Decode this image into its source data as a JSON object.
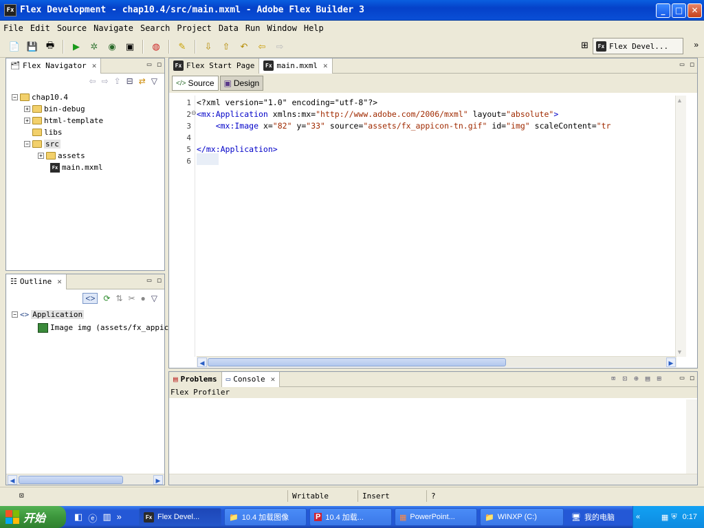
{
  "window": {
    "title": "Flex Development - chap10.4/src/main.mxml - Adobe Flex Builder 3",
    "app_badge": "Fx",
    "minimize": "_",
    "maximize": "□",
    "close": "✕"
  },
  "menu": [
    "File",
    "Edit",
    "Source",
    "Navigate",
    "Search",
    "Project",
    "Data",
    "Run",
    "Window",
    "Help"
  ],
  "perspective": {
    "label": "Flex Devel...",
    "more": "»"
  },
  "navigator": {
    "tab": "Flex Navigator",
    "items": [
      {
        "label": "chap10.4",
        "level": 0,
        "exp": "−",
        "icon": "project"
      },
      {
        "label": "bin-debug",
        "level": 1,
        "exp": "+",
        "icon": "folder"
      },
      {
        "label": "html-template",
        "level": 1,
        "exp": "+",
        "icon": "folder"
      },
      {
        "label": "libs",
        "level": 1,
        "exp": "",
        "icon": "folder"
      },
      {
        "label": "src",
        "level": 1,
        "exp": "−",
        "icon": "folder"
      },
      {
        "label": "assets",
        "level": 2,
        "exp": "+",
        "icon": "folder"
      },
      {
        "label": "main.mxml",
        "level": 2,
        "exp": "",
        "icon": "mxml"
      }
    ]
  },
  "outline": {
    "tab": "Outline",
    "items": [
      {
        "label": "Application",
        "level": 0
      },
      {
        "label": "Image img (assets/fx_appicon",
        "level": 1
      }
    ]
  },
  "editor": {
    "tabs": [
      "Flex Start Page",
      "main.mxml"
    ],
    "modes": {
      "source": "Source",
      "design": "Design"
    },
    "lines": [
      [
        {
          "t": "<?xml version=\"1.0\" encoding=\"utf-8\"?>",
          "c": "att"
        }
      ],
      [
        {
          "t": "<mx:Application",
          "c": "tag"
        },
        {
          "t": " xmlns:mx=",
          "c": "att"
        },
        {
          "t": "\"http://www.adobe.com/2006/mxml\"",
          "c": "str"
        },
        {
          "t": " layout=",
          "c": "att"
        },
        {
          "t": "\"absolute\"",
          "c": "str"
        },
        {
          "t": ">",
          "c": "tag"
        }
      ],
      [
        {
          "t": "    <mx:Image",
          "c": "tag"
        },
        {
          "t": " x=",
          "c": "att"
        },
        {
          "t": "\"82\"",
          "c": "str"
        },
        {
          "t": " y=",
          "c": "att"
        },
        {
          "t": "\"33\"",
          "c": "str"
        },
        {
          "t": " source=",
          "c": "att"
        },
        {
          "t": "\"assets/fx_appicon-tn.gif\"",
          "c": "str"
        },
        {
          "t": " id=",
          "c": "att"
        },
        {
          "t": "\"img\"",
          "c": "str"
        },
        {
          "t": " scaleContent=",
          "c": "att"
        },
        {
          "t": "\"tr",
          "c": "str"
        }
      ],
      [
        {
          "t": "",
          "c": "att"
        }
      ],
      [
        {
          "t": "</mx:Application>",
          "c": "tag"
        }
      ],
      [
        {
          "t": "",
          "c": "att"
        }
      ]
    ],
    "line_numbers": [
      "1",
      "2",
      "3",
      "4",
      "5",
      "6"
    ]
  },
  "bottom": {
    "tabs": [
      "Problems",
      "Console"
    ],
    "console_title": "Flex Profiler"
  },
  "status": {
    "writable": "Writable",
    "insert": "Insert",
    "extra": "?"
  },
  "taskbar": {
    "start": "开始",
    "quick_more": "»",
    "tasks": [
      "Flex Devel...",
      "10.4 加载图像",
      "10.4 加载...",
      "PowerPoint...",
      "WINXP (C:)",
      "我的电脑"
    ],
    "tray_more": "«",
    "clock": "0:17"
  }
}
